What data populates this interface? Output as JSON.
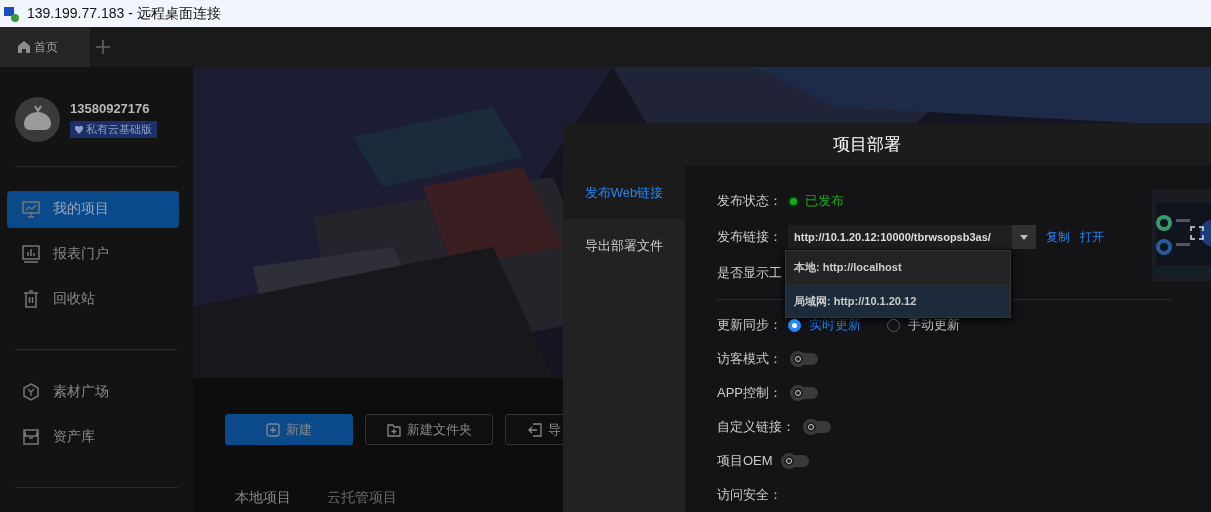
{
  "window": {
    "title": "139.199.77.183 - 远程桌面连接"
  },
  "tabs": [
    {
      "label": "首页",
      "selected": true
    }
  ],
  "user": {
    "name": "13580927176",
    "badge": "私有云基础版"
  },
  "sidebar": {
    "groups": [
      [
        {
          "label": "我的项目",
          "selected": true
        },
        {
          "label": "报表门户",
          "selected": false
        },
        {
          "label": "回收站",
          "selected": false
        }
      ],
      [
        {
          "label": "素材广场",
          "selected": false
        },
        {
          "label": "资产库",
          "selected": false
        }
      ]
    ]
  },
  "toolbar": {
    "buttons": [
      {
        "label": "新建",
        "primary": true
      },
      {
        "label": "新建文件夹",
        "primary": false
      },
      {
        "label": "导",
        "primary": false
      }
    ]
  },
  "project_tabs": [
    {
      "label": "本地项目",
      "selected": true
    },
    {
      "label": "云托管项目",
      "selected": false
    }
  ],
  "dialog": {
    "title": "项目部署",
    "nav": [
      {
        "label": "发布Web链接",
        "selected": true
      },
      {
        "label": "导出部署文件",
        "selected": false
      }
    ],
    "status": {
      "label": "发布状态：",
      "value": "已发布"
    },
    "link": {
      "label": "发布链接：",
      "value": "http://10.1.20.12:10000/tbrwsopsb3as/",
      "expanded": true,
      "actions": [
        "复制",
        "打开"
      ],
      "options": [
        {
          "label": "本地: http://localhost",
          "selected": false
        },
        {
          "label": "局域网: http://10.1.20.12",
          "selected": true
        }
      ]
    },
    "toolbar_label": "是否显示工",
    "sync": {
      "label": "更新同步：",
      "options": [
        {
          "label": "实时更新",
          "selected": true
        },
        {
          "label": "手动更新",
          "selected": false
        }
      ]
    },
    "switches": [
      {
        "label": "访客模式：",
        "on": false
      },
      {
        "label": "APP控制：",
        "on": false
      },
      {
        "label": "自定义链接：",
        "on": false
      },
      {
        "label": "项目OEM",
        "on": false
      }
    ],
    "last_label": "访问安全："
  }
}
